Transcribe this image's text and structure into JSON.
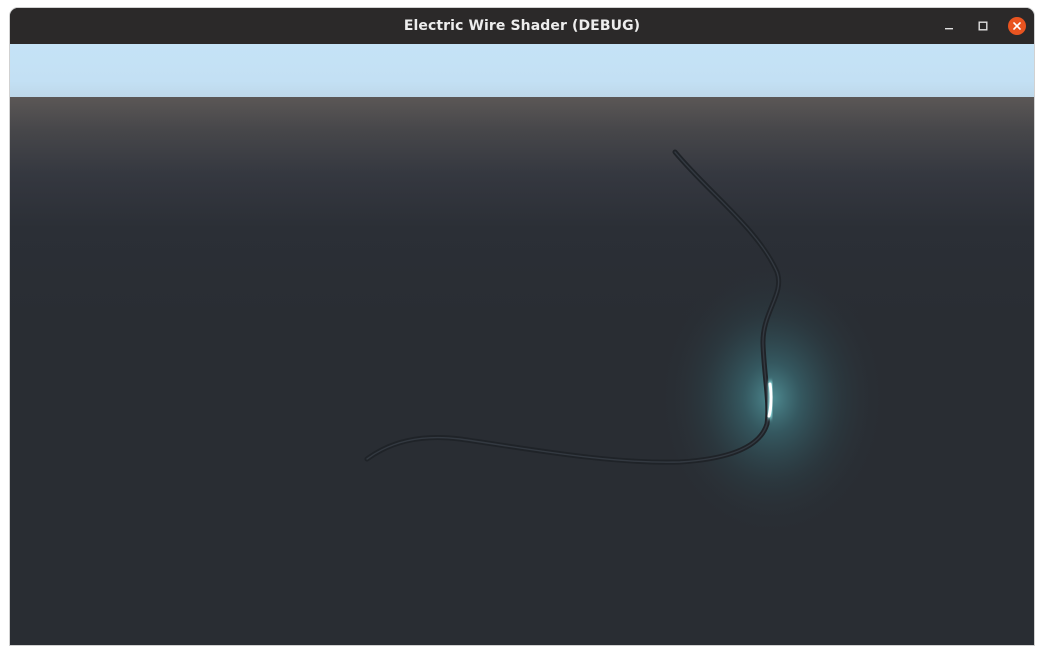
{
  "window": {
    "title": "Electric Wire Shader (DEBUG)",
    "controls": [
      "minimize",
      "maximize",
      "close"
    ],
    "close_color": "#e95420"
  },
  "scene": {
    "sky_color": "#c5e3f6",
    "ground_color": "#292d33",
    "wire_color": "#23272c",
    "glow_color": "#7fe6ec",
    "icons": [
      "minimize-icon",
      "maximize-icon",
      "close-icon"
    ]
  }
}
